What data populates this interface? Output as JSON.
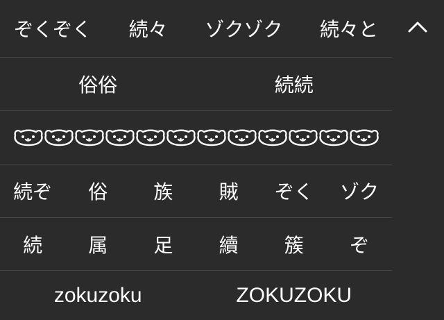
{
  "candidates": {
    "row1": [
      "ぞくぞく",
      "続々",
      "ゾクゾク",
      "続々と"
    ],
    "row2": [
      "俗俗",
      "続続"
    ],
    "row3": [
      "ఌ(⁻`ʷ´⁻)ఌ(⁻`ʷ´⁻)ఌ(⁻`ʷ´⁻)ఌ(⁻`ʷ´⁻)ఌ(⁻`ʷ´⁻)ఌ(⁻`ʷ´⁻)"
    ],
    "row4": [
      "続ぞ",
      "俗",
      "族",
      "賊",
      "ぞく",
      "ゾク"
    ],
    "row5": [
      "続",
      "属",
      "足",
      "續",
      "簇",
      "ぞ"
    ],
    "row6": [
      "zokuzoku",
      "ZOKUZOKU"
    ]
  },
  "collapse_icon": "chevron-up-icon",
  "colors": {
    "background": "#2b2b2b",
    "divider": "#464646",
    "text": "#ffffff"
  }
}
